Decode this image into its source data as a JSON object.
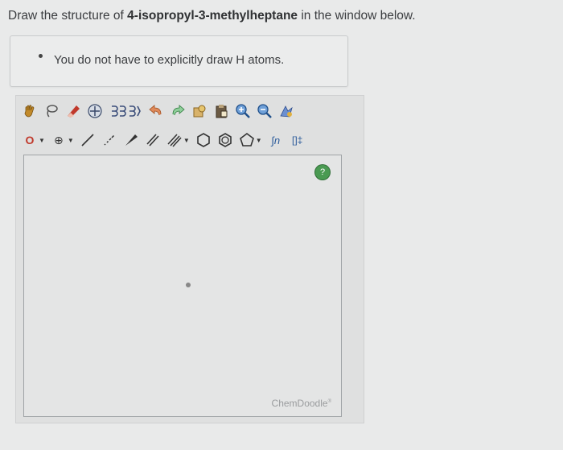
{
  "question": {
    "prefix": "Draw the structure of ",
    "compound": "4-isopropyl-3-methylheptane",
    "suffix": " in the window below."
  },
  "hint": {
    "text": "You do not have to explicitly draw H atoms."
  },
  "editor": {
    "toolbar_row1": [
      {
        "name": "hand-icon"
      },
      {
        "name": "lasso-icon"
      },
      {
        "name": "eraser-icon"
      },
      {
        "name": "center-icon"
      },
      {
        "name": "flip-icon"
      },
      {
        "name": "undo-icon"
      },
      {
        "name": "redo-icon"
      },
      {
        "name": "copy-icon"
      },
      {
        "name": "paste-icon"
      },
      {
        "name": "zoom-in-icon"
      },
      {
        "name": "zoom-out-icon"
      },
      {
        "name": "clean-icon"
      }
    ],
    "toolbar_row2": {
      "atom_label": "O",
      "charge_label": "⊕",
      "sgroup_label": "∫n",
      "bracket_label": "[]‡"
    },
    "help_label": "?",
    "brand": "ChemDoodle",
    "brand_mark": "®"
  },
  "colors": {
    "page_bg": "#e9eaea",
    "help_green": "#4a9a52",
    "eraser_red": "#c0392b",
    "undo_red": "#d35400",
    "redo_green": "#27ae60",
    "zoom_blue": "#2c6fb7"
  }
}
